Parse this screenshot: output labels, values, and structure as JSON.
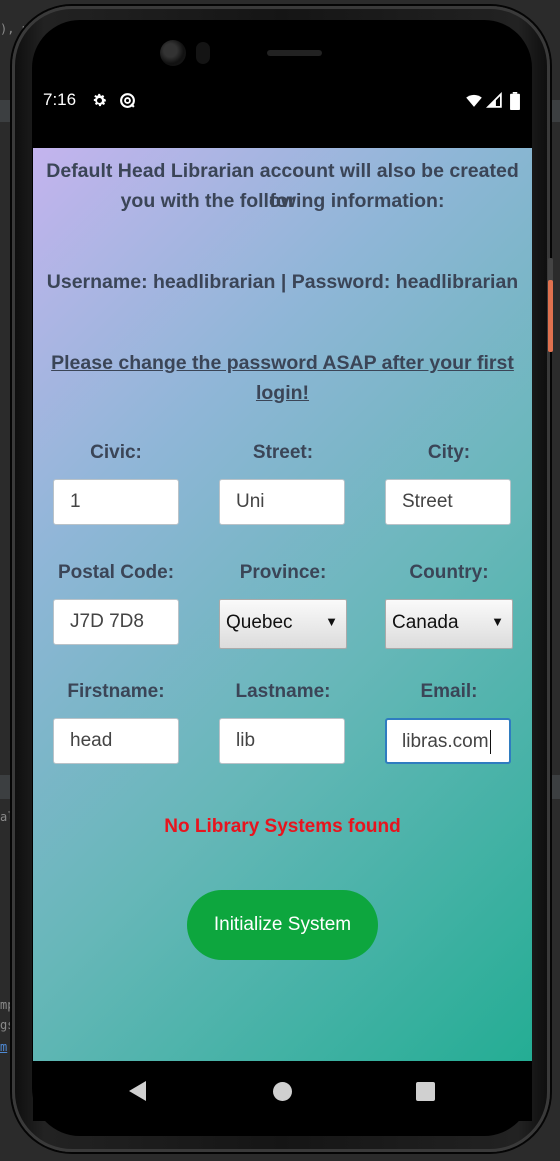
{
  "status_bar": {
    "time": "7:16",
    "icons": [
      "gear-icon",
      "at-sign-icon",
      "wifi-icon",
      "signal-icon",
      "battery-icon"
    ]
  },
  "header": {
    "line1": "Default Head Librarian account will also be created for",
    "line2": "you with the following information:",
    "credentials": "Username: headlibrarian | Password: headlibrarian",
    "warning_line1": "Please change the password ASAP after your first",
    "warning_line2": "login!"
  },
  "form": {
    "civic": {
      "label": "Civic:",
      "value": "1"
    },
    "street": {
      "label": "Street:",
      "value": "Uni"
    },
    "city": {
      "label": "City:",
      "value": "Street"
    },
    "postal_code": {
      "label": "Postal Code:",
      "value": "J7D 7D8"
    },
    "province": {
      "label": "Province:",
      "value": "Quebec"
    },
    "country": {
      "label": "Country:",
      "value": "Canada"
    },
    "firstname": {
      "label": "Firstname:",
      "value": "head"
    },
    "lastname": {
      "label": "Lastname:",
      "value": "lib"
    },
    "email": {
      "label": "Email:",
      "value": "libras.com"
    }
  },
  "error_message": "No Library Systems found",
  "initialize_button": "Initialize System",
  "colors": {
    "accent_button": "#0da63e",
    "error": "#e8141e",
    "gradient_start": "#c4b4ee",
    "gradient_end": "#24ad94"
  },
  "ide_backdrop": {
    "top_fragment": "), p",
    "mid_fragment": "al",
    "low_fragment_1": "mp",
    "low_fragment_2": "gs",
    "link_fragment": "m"
  }
}
